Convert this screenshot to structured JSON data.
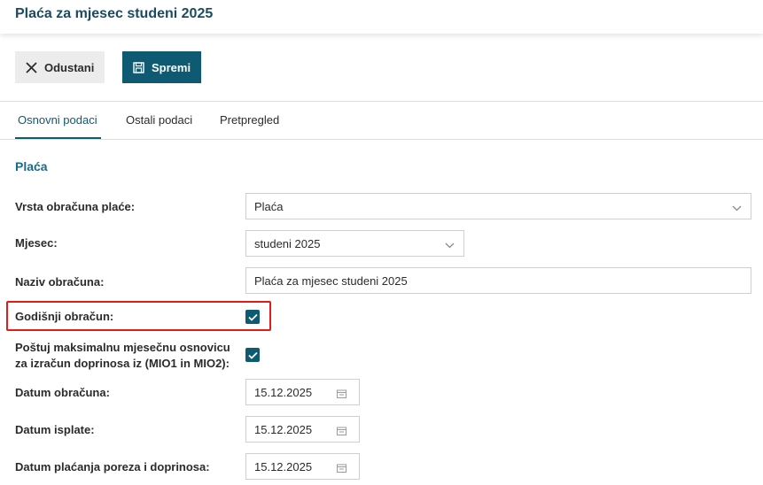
{
  "page": {
    "title": "Plaća za mjesec studeni 2025"
  },
  "toolbar": {
    "cancel_label": "Odustani",
    "save_label": "Spremi"
  },
  "tabs": [
    {
      "label": "Osnovni podaci",
      "active": true
    },
    {
      "label": "Ostali podaci",
      "active": false
    },
    {
      "label": "Pretpregled",
      "active": false
    }
  ],
  "section": {
    "title": "Plaća"
  },
  "form": {
    "vrsta": {
      "label": "Vrsta obračuna plaće:",
      "value": "Plaća"
    },
    "mjesec": {
      "label": "Mjesec:",
      "value": "studeni 2025"
    },
    "naziv": {
      "label": "Naziv obračuna:",
      "value": "Plaća za mjesec studeni 2025"
    },
    "godisnji": {
      "label": "Godišnji obračun:",
      "checked": true
    },
    "postuj": {
      "label_line1": "Poštuj maksimalnu mjesečnu osnovicu",
      "label_line2": "za izračun doprinosa iz (MIO1 in MIO2):",
      "checked": true
    },
    "datum_obracuna": {
      "label": "Datum obračuna:",
      "value": "15.12.2025"
    },
    "datum_isplate": {
      "label": "Datum isplate:",
      "value": "15.12.2025"
    },
    "datum_placanja": {
      "label": "Datum plaćanja poreza i doprinosa:",
      "value": "15.12.2025"
    }
  },
  "colors": {
    "accent": "#0d5a72",
    "highlight": "#e01d1d",
    "title": "#1c4b60"
  }
}
